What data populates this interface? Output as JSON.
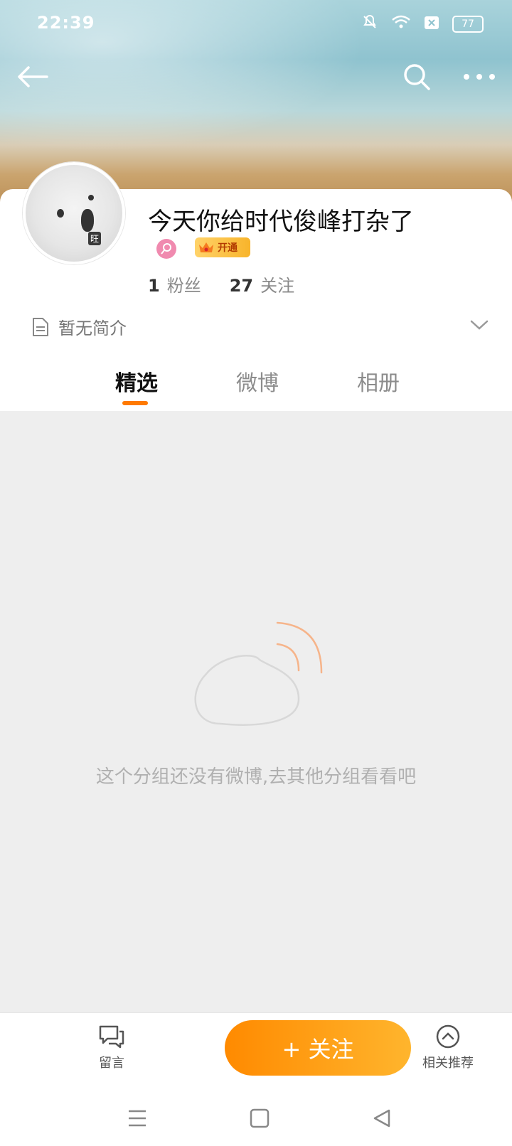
{
  "status_bar": {
    "time": "22:39",
    "battery": "77"
  },
  "profile": {
    "username": "今天你给时代俊峰打杂了",
    "avatar_tag": "旺",
    "vip_label": "开通",
    "fans_count": "1",
    "fans_label": "粉丝",
    "following_count": "27",
    "following_label": "关注",
    "intro": "暂无简介"
  },
  "tabs": [
    {
      "label": "精选",
      "active": true
    },
    {
      "label": "微博",
      "active": false
    },
    {
      "label": "相册",
      "active": false
    }
  ],
  "feed": {
    "empty_text": "这个分组还没有微博,去其他分组看看吧"
  },
  "bottom_bar": {
    "comment_label": "留言",
    "follow_label": "+ 关注",
    "recommend_label": "相关推荐"
  },
  "colors": {
    "accent": "#ff7a00",
    "feed_bg": "#eeeeee"
  }
}
